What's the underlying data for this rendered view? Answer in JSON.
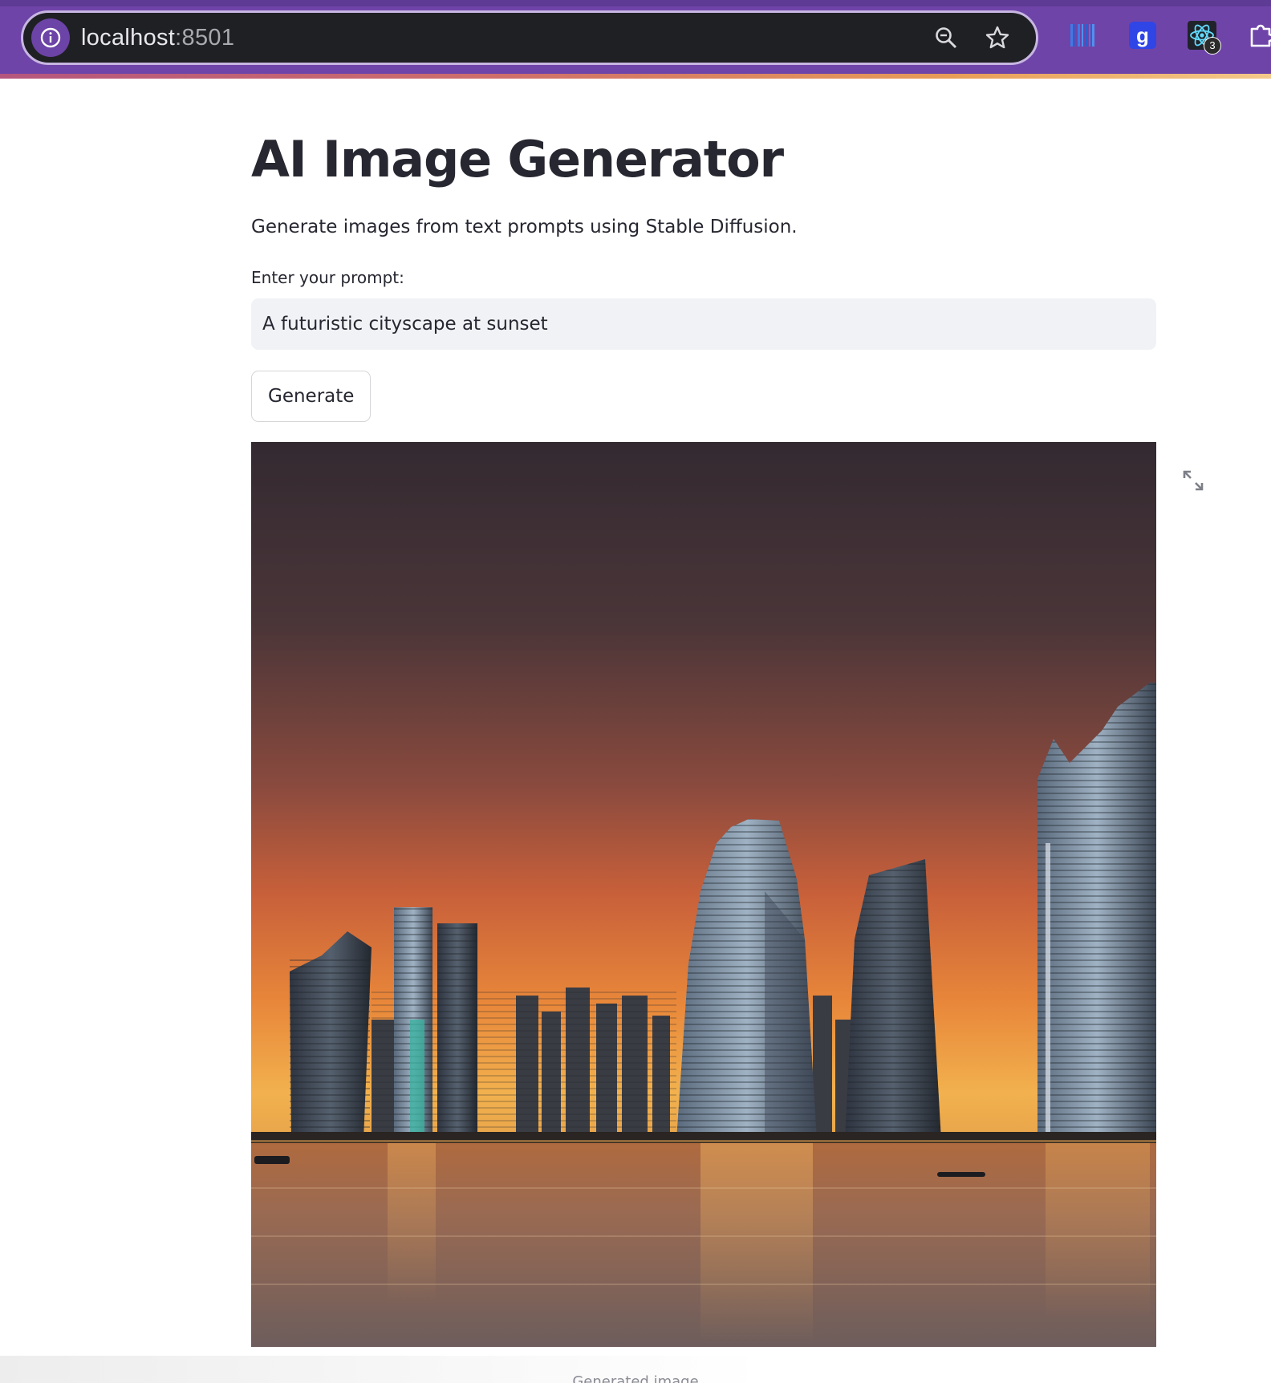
{
  "browser": {
    "url_host": "localhost",
    "url_port": ":8501",
    "toolbar_icons": [
      "site-info-icon",
      "zoom-out-icon",
      "bookmark-star-icon"
    ],
    "extensions": [
      {
        "name": "bars-extension-icon"
      },
      {
        "name": "grammar-g-extension-icon",
        "glyph": "g"
      },
      {
        "name": "react-devtools-icon",
        "badge": "3"
      },
      {
        "name": "puzzle-extensions-icon"
      }
    ],
    "colors": {
      "frame": "#6f44a8",
      "address_bg": "#1f2024"
    }
  },
  "app": {
    "title": "AI Image Generator",
    "subtitle": "Generate images from text prompts using Stable Diffusion.",
    "prompt_label": "Enter your prompt:",
    "prompt_value": "A futuristic cityscape at sunset",
    "generate_label": "Generate",
    "image_alt": "Generated image of a futuristic city skyline at sunset over water",
    "caption": "Generated image"
  }
}
